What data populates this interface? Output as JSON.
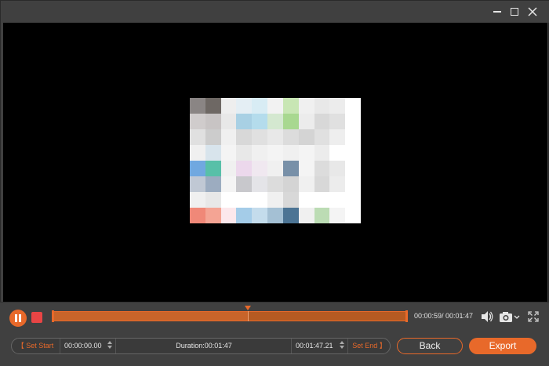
{
  "window": {
    "buttons": {
      "minimize": "minimize-icon",
      "maximize": "maximize-icon",
      "close": "close-icon"
    }
  },
  "preview": {
    "thumbnail_colors": [
      "#8a8584",
      "#6e6864",
      "#eeeeee",
      "#e4eef4",
      "#d8ecf4",
      "#f2f2f2",
      "#c8e6b4",
      "#f0f0f0",
      "#e8e8e8",
      "#ececec",
      "#ffffff",
      "#d0cccc",
      "#c8c4c4",
      "#e8e8e8",
      "#a8d0e4",
      "#b4dcec",
      "#d4e8d0",
      "#a8d890",
      "#ececec",
      "#d8d8d8",
      "#e0e0e0",
      "#ffffff",
      "#e0e0e0",
      "#cccccc",
      "#f0f0f0",
      "#d8d8d8",
      "#e0e0e0",
      "#e8e8e8",
      "#dcdcdc",
      "#d4d4d4",
      "#e0e0e0",
      "#eeeeee",
      "#ffffff",
      "#f0f0f0",
      "#d8e4ec",
      "#f4f4f4",
      "#e8e8e8",
      "#f0f0f0",
      "#f4f4f4",
      "#f0f0f0",
      "#f4f4f4",
      "#ececec",
      "#ffffff",
      "#ffffff",
      "#70a8e0",
      "#58c0a8",
      "#f0f0f0",
      "#ecd8ec",
      "#f0e8f0",
      "#f0f0f0",
      "#7890a8",
      "#f4f4f4",
      "#dcdcdc",
      "#e8e8e8",
      "#ffffff",
      "#c0c8d4",
      "#9cacc0",
      "#f4f4f4",
      "#c8c8cc",
      "#e4e4e8",
      "#dcdcdc",
      "#d4d4d4",
      "#f0f0f0",
      "#d8d8d8",
      "#ececec",
      "#ffffff",
      "#f0f0f0",
      "#e8e8e8",
      "#ffffff",
      "#ffffff",
      "#ffffff",
      "#f0f0f0",
      "#d8d8d8",
      "#ffffff",
      "#ffffff",
      "#ffffff",
      "#ffffff",
      "#f08878",
      "#f4a494",
      "#fce8ec",
      "#a4cce8",
      "#c4dcec",
      "#a4c0d4",
      "#4c7494",
      "#f0f0f0",
      "#bcdcb4",
      "#f4f4f4",
      "#ffffff"
    ]
  },
  "playback": {
    "current_time": "00:00:59",
    "total_time": "00:01:47",
    "time_label": "00:00:59/ 00:01:47",
    "progress": 0.551
  },
  "icons": {
    "play_pause": "pause-icon",
    "stop": "stop-icon",
    "volume": "volume-icon",
    "snapshot": "camera-icon",
    "fullscreen": "fullscreen-icon"
  },
  "trim": {
    "set_start_label": "【 Set Start",
    "start_value": "00:00:00.00",
    "duration_label": "Duration:00:01:47",
    "end_value": "00:01:47.21",
    "set_end_label": "Set End 】"
  },
  "actions": {
    "back_label": "Back",
    "export_label": "Export"
  },
  "colors": {
    "accent": "#e8692a",
    "stop": "#e84545",
    "background": "#404040",
    "preview_bg": "#000000"
  }
}
